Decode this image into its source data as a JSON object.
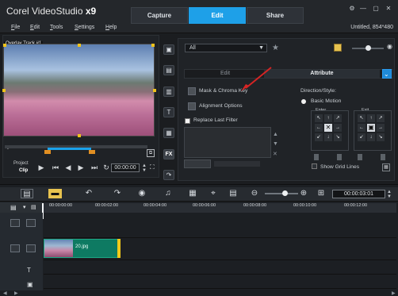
{
  "app": {
    "brand": "Corel VideoStudio",
    "version": "x9"
  },
  "tabs": [
    {
      "label": "Capture"
    },
    {
      "label": "Edit"
    },
    {
      "label": "Share"
    }
  ],
  "menu": [
    {
      "label": "File",
      "ul": "F",
      "rest": "ile"
    },
    {
      "label": "Edit",
      "ul": "E",
      "rest": "dit"
    },
    {
      "label": "Tools",
      "ul": "T",
      "rest": "ools"
    },
    {
      "label": "Settings",
      "ul": "S",
      "rest": "ettings"
    },
    {
      "label": "Help",
      "ul": "H",
      "rest": "elp"
    }
  ],
  "project": {
    "info": "Untitled, 854*480"
  },
  "preview": {
    "overlay_label": "Overlay Track #1",
    "project_label": "Project",
    "clip_label": "Clip",
    "timecode": "00:00:00"
  },
  "library": {
    "dropdown": "All",
    "tab_edit": "Edit",
    "tab_attribute": "Attribute",
    "options": {
      "mask": "Mask & Chroma Key",
      "alignment": "Alignment Options",
      "replace": "Replace Last Filter"
    },
    "direction": {
      "title": "Direction/Style:",
      "basic": "Basic Motion",
      "enter": "Enter",
      "exit": "Exit",
      "show_grid": "Show Grid Lines"
    }
  },
  "timeline": {
    "timecode": "00:00:03:01",
    "clip": "20.jpg",
    "ruler": [
      "00:00:00:00",
      "00:00:02:00",
      "00:00:04:00",
      "00:00:06:00",
      "00:00:08:00",
      "00:00:10:00",
      "00:00:12:00"
    ]
  },
  "colors": {
    "accent": "#1ea0e8",
    "clip": "#0e7a62",
    "marker": "#e18f22",
    "arrow": "#d62424"
  }
}
